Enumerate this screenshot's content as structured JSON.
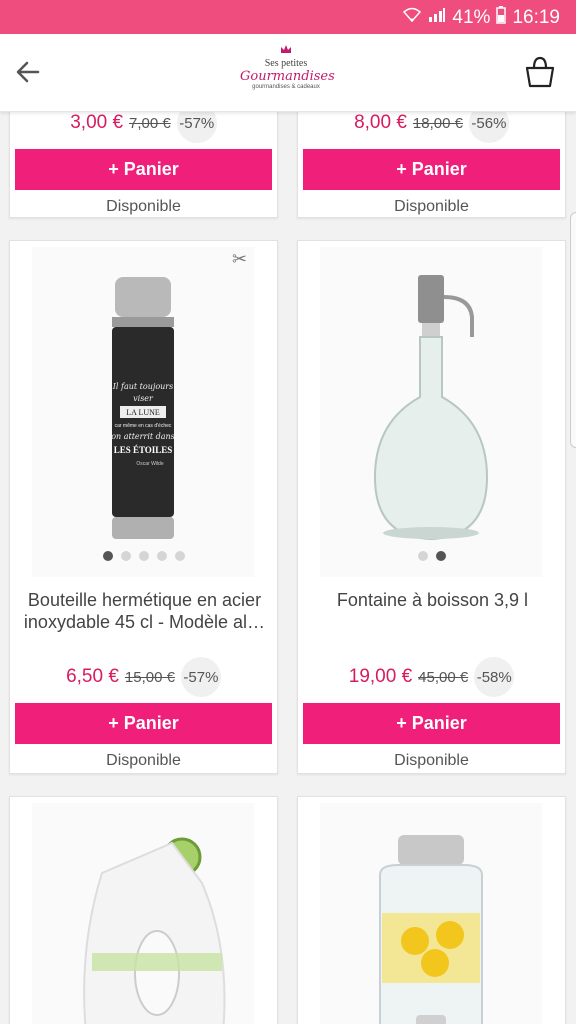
{
  "status": {
    "battery": "41%",
    "time": "16:19"
  },
  "header": {
    "logo_top": "Ses petites",
    "logo_main": "Gourmandises",
    "logo_sub": "gourmandises & cadeaux"
  },
  "products": [
    {
      "price": "3,00 €",
      "old_price": "7,00 €",
      "discount": "-57%",
      "button": "+ Panier",
      "availability": "Disponible"
    },
    {
      "price": "8,00 €",
      "old_price": "18,00 €",
      "discount": "-56%",
      "button": "+ Panier",
      "availability": "Disponible"
    },
    {
      "title": "Bouteille hermétique en acier inoxydable 45 cl - Modèle al…",
      "price": "6,50 €",
      "old_price": "15,00 €",
      "discount": "-57%",
      "button": "+ Panier",
      "availability": "Disponible",
      "bottle_text": [
        "Il faut toujours",
        "viser",
        "LA LUNE",
        "car même en cas d'échec",
        "on atterrit dans",
        "LES ÉTOILES",
        "Oscar Wilde"
      ]
    },
    {
      "title": "Fontaine à boisson 3,9 l",
      "price": "19,00 €",
      "old_price": "45,00 €",
      "discount": "-58%",
      "button": "+ Panier",
      "availability": "Disponible"
    }
  ],
  "colors": {
    "status": "#ee4d7e",
    "button": "#ef1f7a",
    "price": "#d81b60"
  }
}
